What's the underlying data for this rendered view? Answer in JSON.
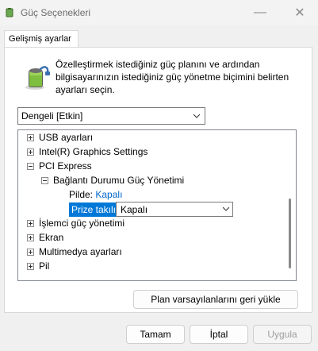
{
  "window": {
    "title": "Güç Seçenekleri",
    "minimize_glyph": "—",
    "close_glyph": "✕"
  },
  "tab": {
    "label": "Gelişmiş ayarlar"
  },
  "intro": {
    "text": "Özelleştirmek istediğiniz güç planını ve ardından bilgisayarınızın istediğiniz güç yönetme biçimini belirten ayarları seçin.",
    "icon": "battery-plug-icon"
  },
  "plan_select": {
    "value": "Dengeli [Etkin]"
  },
  "tree": {
    "items": [
      {
        "label": "USB ayarları",
        "state": "collapsed"
      },
      {
        "label": "Intel(R) Graphics Settings",
        "state": "collapsed"
      },
      {
        "label": "PCI Express",
        "state": "expanded"
      },
      {
        "label": "Bağlantı Durumu Güç Yönetimi",
        "state": "expanded"
      },
      {
        "label": "İşlemci güç yönetimi",
        "state": "collapsed"
      },
      {
        "label": "Ekran",
        "state": "collapsed"
      },
      {
        "label": "Multimedya ayarları",
        "state": "collapsed"
      },
      {
        "label": "Pil",
        "state": "collapsed"
      }
    ],
    "on_battery": {
      "label": "Pilde:",
      "value": "Kapalı"
    },
    "plugged_in": {
      "label": "Prize takılı:",
      "value": "Kapalı"
    }
  },
  "buttons": {
    "restore_defaults": "Plan varsayılanlarını geri yükle",
    "ok": "Tamam",
    "cancel": "İptal",
    "apply": "Uygula"
  },
  "colors": {
    "accent": "#0078d7",
    "link": "#0066cc",
    "disabled_text": "#9e9e9e"
  }
}
